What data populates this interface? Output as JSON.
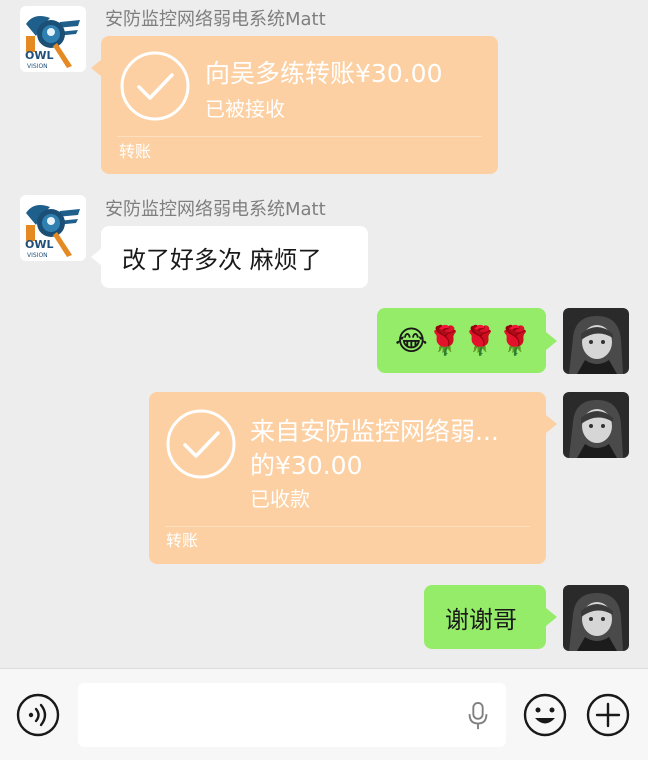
{
  "messages": [
    {
      "type": "transfer",
      "side": "left",
      "sender": "安防监控网络弱电系统Matt",
      "title": "向吴多练转账¥30.00",
      "status": "已被接收",
      "footer": "转账"
    },
    {
      "type": "text",
      "side": "left",
      "sender": "安防监控网络弱电系统Matt",
      "text": "改了好多次 麻烦了"
    },
    {
      "type": "emoji",
      "side": "right",
      "emoji": "😂🌹🌹🌹"
    },
    {
      "type": "transfer",
      "side": "right",
      "title_line1": "来自安防监控网络弱...",
      "title_line2": "的¥30.00",
      "status": "已收款",
      "footer": "转账"
    },
    {
      "type": "text",
      "side": "right",
      "text": "谢谢哥"
    }
  ],
  "avatars": {
    "left": {
      "logo_text": "OWL",
      "logo_subtext": "VISION"
    }
  },
  "input_bar": {
    "placeholder": "",
    "icons": [
      "voice-icon",
      "microphone-icon",
      "emoji-icon",
      "plus-icon"
    ]
  },
  "colors": {
    "background": "#ededed",
    "transfer_bubble": "#fcd0a2",
    "green_bubble": "#95ec69",
    "white_bubble": "#ffffff",
    "sender_name": "#7f7f7f"
  }
}
